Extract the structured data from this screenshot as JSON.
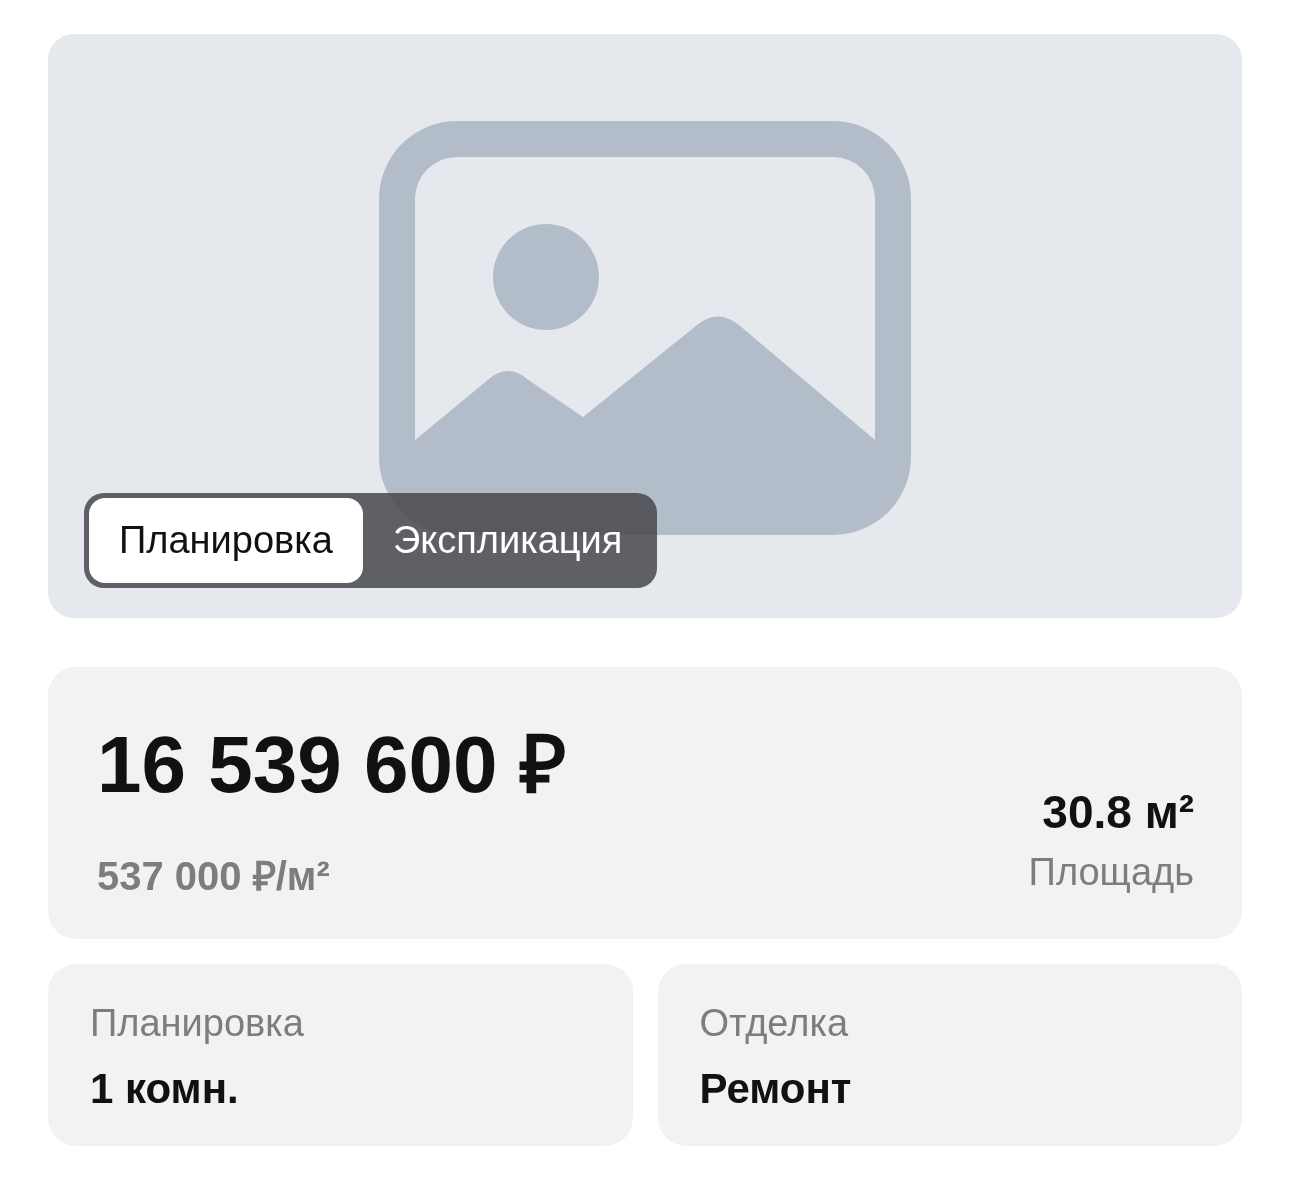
{
  "gallery": {
    "kind": "picture",
    "tabs": [
      {
        "label": "Планировка",
        "selected": true
      },
      {
        "label": "Экспликация",
        "selected": false
      }
    ]
  },
  "price": {
    "total": "16 539 600 ₽",
    "per_meter": "537 000 ₽/м²",
    "area": "30.8 м²",
    "area_label": "Площадь"
  },
  "details": [
    {
      "label": "Планировка",
      "value": "1 комн."
    },
    {
      "label": "Отделка",
      "value": "Ремонт"
    }
  ]
}
